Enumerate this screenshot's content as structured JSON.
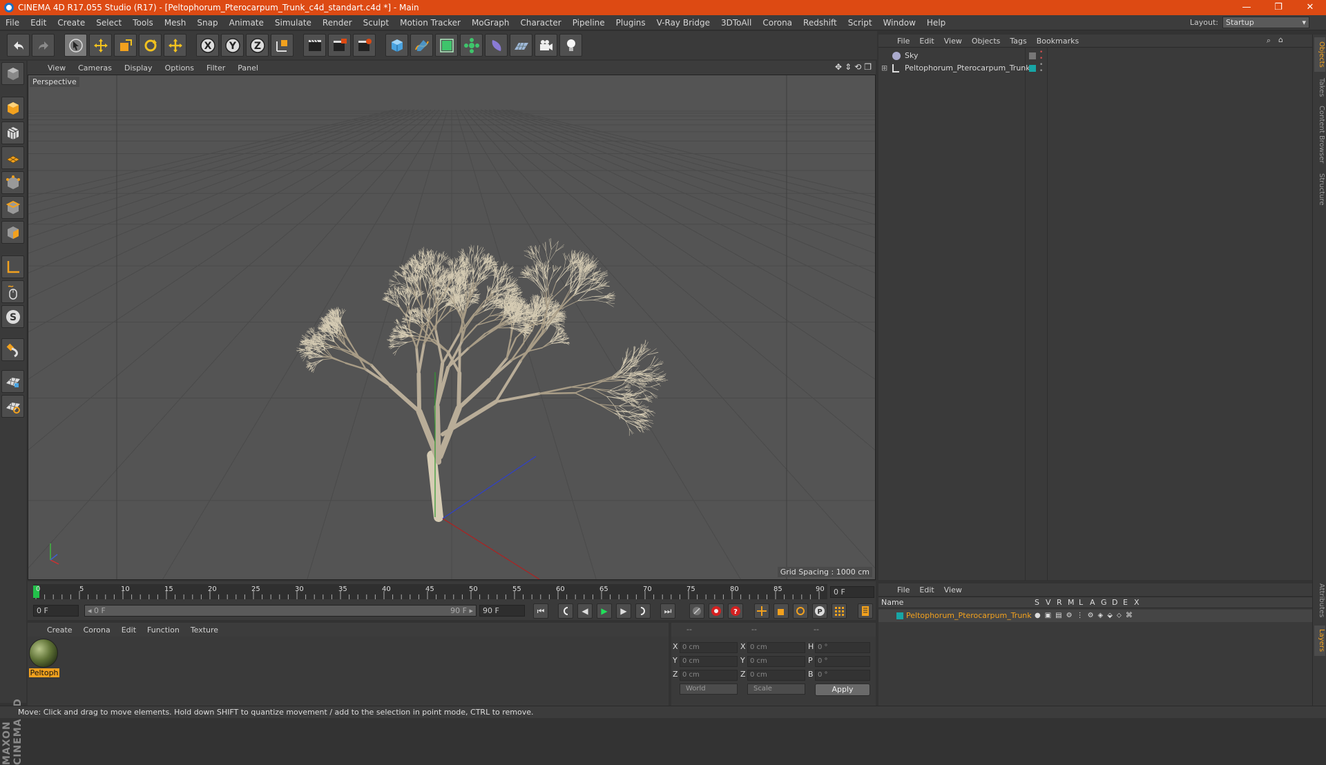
{
  "window": {
    "title": "CINEMA 4D R17.055 Studio (R17) - [Peltophorum_Pterocarpum_Trunk_c4d_standart.c4d *] - Main",
    "controls": [
      "—",
      "❐",
      "✕"
    ]
  },
  "menu": [
    "File",
    "Edit",
    "Create",
    "Select",
    "Tools",
    "Mesh",
    "Snap",
    "Animate",
    "Simulate",
    "Render",
    "Sculpt",
    "Motion Tracker",
    "MoGraph",
    "Character",
    "Pipeline",
    "Plugins",
    "V-Ray Bridge",
    "3DToAll",
    "Corona",
    "Redshift",
    "Script",
    "Window",
    "Help"
  ],
  "layout": {
    "label": "Layout:",
    "value": "Startup"
  },
  "toolbar_icons": [
    "undo-icon",
    "redo-icon",
    "live-selection-icon",
    "move-icon",
    "scale-icon",
    "rotate-icon",
    "recent-tool-icon",
    "x-axis-icon",
    "y-axis-icon",
    "z-axis-icon",
    "coordinate-system-icon",
    "render-view-icon",
    "render-picture-viewer-icon",
    "render-settings-icon",
    "cube-icon",
    "spline-pen-icon",
    "subdivision-icon",
    "array-icon",
    "deformer-icon",
    "floor-icon",
    "camera-icon",
    "light-icon"
  ],
  "axis_letters": {
    "x": "X",
    "y": "Y",
    "z": "Z"
  },
  "left_icons": [
    "model-mode-icon",
    "texture-mode-icon",
    "workplane-icon",
    "points-mode-icon",
    "edges-mode-icon",
    "polygons-mode-icon",
    "axis-mode-icon",
    "tweak-mode-icon",
    "snap-icon",
    "magnet-icon",
    "lock-workplane-icon",
    "planar-workplane-icon"
  ],
  "brand": "MAXON CINEMA 4D",
  "viewport": {
    "menu": [
      "View",
      "Cameras",
      "Display",
      "Options",
      "Filter",
      "Panel"
    ],
    "label": "Perspective",
    "grid_spacing": "Grid Spacing : 1000 cm",
    "nav_glyphs": [
      "✥",
      "⇕",
      "⟲",
      "❐"
    ]
  },
  "timeline": {
    "ticks": [
      "0",
      "5",
      "10",
      "15",
      "20",
      "25",
      "30",
      "35",
      "40",
      "45",
      "50",
      "55",
      "60",
      "65",
      "70",
      "75",
      "80",
      "85",
      "90"
    ],
    "current_frame": "0 F",
    "start_field": "0 F",
    "range_start": "◂ 0 F",
    "range_end": "90 F ▸",
    "end_field": "90 F"
  },
  "transport_glyphs": {
    "first": "⏮",
    "prev_key": "◀",
    "play": "▶",
    "next_key": "▶",
    "last": "⏭"
  },
  "materials": {
    "menu": [
      "Create",
      "Corona",
      "Edit",
      "Function",
      "Texture"
    ],
    "items": [
      {
        "name": "Peltoph"
      }
    ]
  },
  "coordinates": {
    "header": [
      "--",
      "--",
      "--"
    ],
    "rows": [
      {
        "a": "X",
        "av": "0 cm",
        "b": "X",
        "bv": "0 cm",
        "c": "H",
        "cv": "0 °"
      },
      {
        "a": "Y",
        "av": "0 cm",
        "b": "Y",
        "bv": "0 cm",
        "c": "P",
        "cv": "0 °"
      },
      {
        "a": "Z",
        "av": "0 cm",
        "b": "Z",
        "bv": "0 cm",
        "c": "B",
        "cv": "0 °"
      }
    ],
    "space": "World",
    "mode": "Scale",
    "apply": "Apply"
  },
  "status": "Move: Click and drag to move elements. Hold down SHIFT to quantize movement / add to the selection in point mode, CTRL to remove.",
  "objects": {
    "menu": [
      "File",
      "Edit",
      "View",
      "Objects",
      "Tags",
      "Bookmarks"
    ],
    "items": [
      {
        "name": "Sky",
        "color": "#888888"
      },
      {
        "name": "Peltophorum_Pterocarpum_Trunk",
        "color": "#18a6a6"
      }
    ]
  },
  "layers": {
    "menu": [
      "File",
      "Edit",
      "View"
    ],
    "columns": [
      "Name",
      "S",
      "V",
      "R",
      "M",
      "L",
      "A",
      "G",
      "D",
      "E",
      "X"
    ],
    "items": [
      {
        "name": "Peltophorum_Pterocarpum_Trunk",
        "color": "#18a6a6"
      }
    ]
  },
  "right_tabs": [
    "Objects",
    "Takes",
    "Content Browser",
    "Structure",
    "Attributes",
    "Layers"
  ],
  "colors": {
    "accent": "#dd4a13",
    "highlight": "#f2a11e"
  }
}
